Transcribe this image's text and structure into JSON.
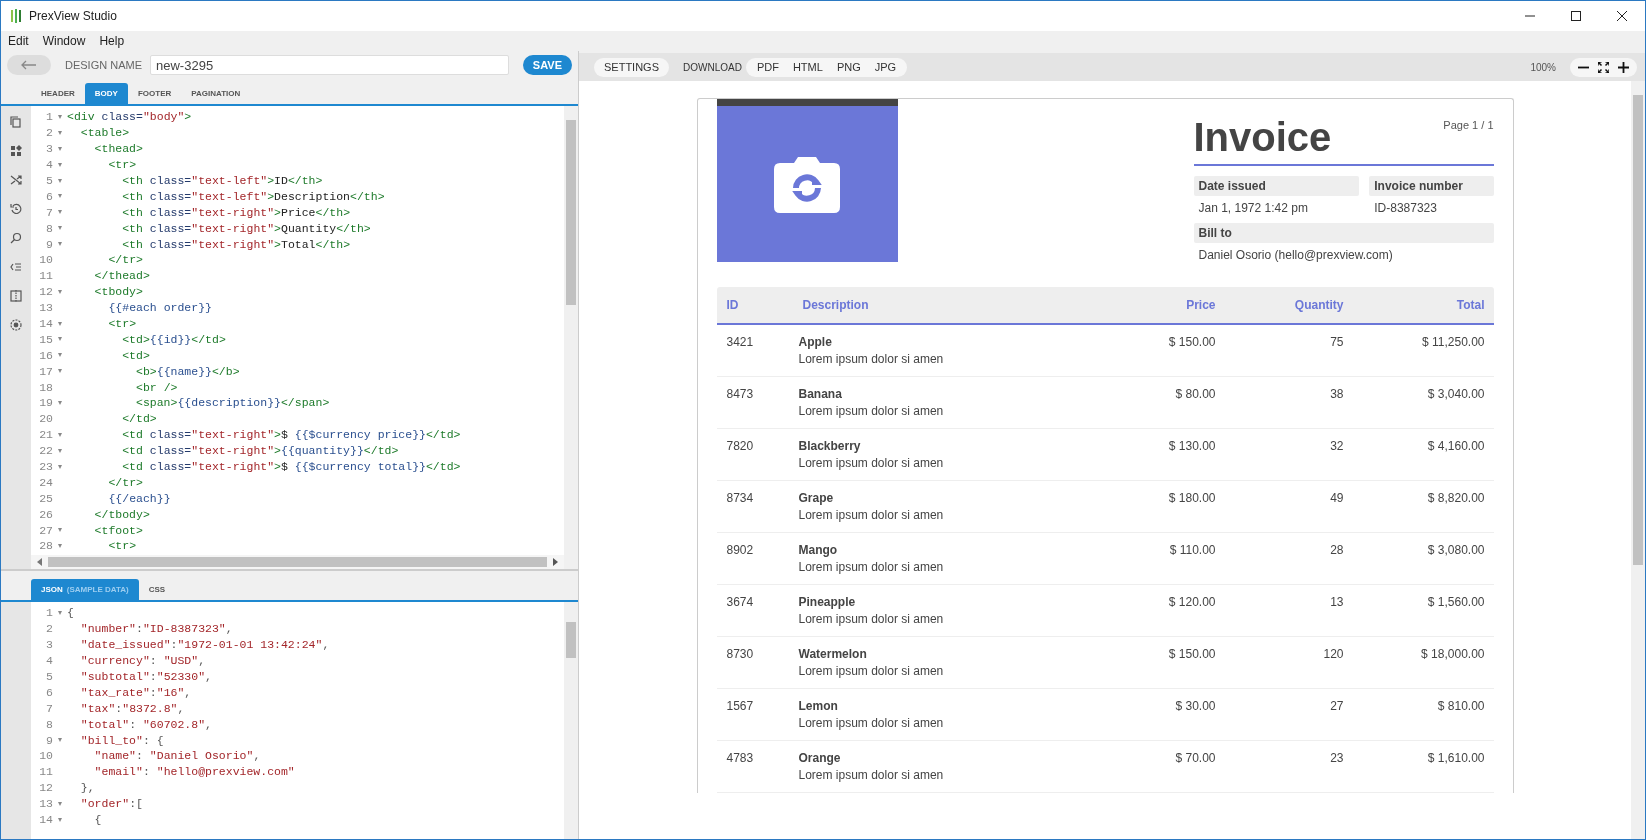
{
  "app": {
    "title": "PrexView Studio"
  },
  "menu": [
    "Edit",
    "Window",
    "Help"
  ],
  "toolbar": {
    "label": "DESIGN NAME",
    "design_name": "new-3295",
    "save": "SAVE"
  },
  "template_tabs": [
    {
      "label": "HEADER",
      "selected": false
    },
    {
      "label": "BODY",
      "selected": true
    },
    {
      "label": "FOOTER",
      "selected": false
    },
    {
      "label": "PAGINATION",
      "selected": false
    }
  ],
  "html_editor": {
    "lines": [
      {
        "n": "1",
        "fold": true,
        "text": "<div class=\"body\">"
      },
      {
        "n": "2",
        "fold": true,
        "text": "  <table>"
      },
      {
        "n": "3",
        "fold": true,
        "text": "    <thead>"
      },
      {
        "n": "4",
        "fold": true,
        "text": "      <tr>"
      },
      {
        "n": "5",
        "fold": true,
        "text": "        <th class=\"text-left\">ID</th>"
      },
      {
        "n": "6",
        "fold": true,
        "text": "        <th class=\"text-left\">Description</th>"
      },
      {
        "n": "7",
        "fold": true,
        "text": "        <th class=\"text-right\">Price</th>"
      },
      {
        "n": "8",
        "fold": true,
        "text": "        <th class=\"text-right\">Quantity</th>"
      },
      {
        "n": "9",
        "fold": true,
        "text": "        <th class=\"text-right\">Total</th>"
      },
      {
        "n": "10",
        "fold": false,
        "text": "      </tr>"
      },
      {
        "n": "11",
        "fold": false,
        "text": "    </thead>"
      },
      {
        "n": "12",
        "fold": true,
        "text": "    <tbody>"
      },
      {
        "n": "13",
        "fold": false,
        "text": "      {{#each order}}"
      },
      {
        "n": "14",
        "fold": true,
        "text": "      <tr>"
      },
      {
        "n": "15",
        "fold": true,
        "text": "        <td>{{id}}</td>"
      },
      {
        "n": "16",
        "fold": true,
        "text": "        <td>"
      },
      {
        "n": "17",
        "fold": true,
        "text": "          <b>{{name}}</b>"
      },
      {
        "n": "18",
        "fold": false,
        "text": "          <br />"
      },
      {
        "n": "19",
        "fold": true,
        "text": "          <span>{{description}}</span>"
      },
      {
        "n": "20",
        "fold": false,
        "text": "        </td>"
      },
      {
        "n": "21",
        "fold": true,
        "text": "        <td class=\"text-right\">$ {{$currency price}}</td>"
      },
      {
        "n": "22",
        "fold": true,
        "text": "        <td class=\"text-right\">{{quantity}}</td>"
      },
      {
        "n": "23",
        "fold": true,
        "text": "        <td class=\"text-right\">$ {{$currency total}}</td>"
      },
      {
        "n": "24",
        "fold": false,
        "text": "      </tr>"
      },
      {
        "n": "25",
        "fold": false,
        "text": "      {{/each}}"
      },
      {
        "n": "26",
        "fold": false,
        "text": "    </tbody>"
      },
      {
        "n": "27",
        "fold": true,
        "text": "    <tfoot>"
      },
      {
        "n": "28",
        "fold": true,
        "text": "      <tr>"
      }
    ]
  },
  "data_tabs": [
    {
      "label": "JSON",
      "note": "(SAMPLE DATA)",
      "selected": true
    },
    {
      "label": "CSS",
      "selected": false
    }
  ],
  "json_editor": {
    "lines": [
      {
        "n": "1",
        "fold": true,
        "text": "{"
      },
      {
        "n": "2",
        "fold": false,
        "text": "  \"number\":\"ID-8387323\","
      },
      {
        "n": "3",
        "fold": false,
        "text": "  \"date_issued\":\"1972-01-01 13:42:24\","
      },
      {
        "n": "4",
        "fold": false,
        "text": "  \"currency\": \"USD\","
      },
      {
        "n": "5",
        "fold": false,
        "text": "  \"subtotal\":\"52330\","
      },
      {
        "n": "6",
        "fold": false,
        "text": "  \"tax_rate\":\"16\","
      },
      {
        "n": "7",
        "fold": false,
        "text": "  \"tax\":\"8372.8\","
      },
      {
        "n": "8",
        "fold": false,
        "text": "  \"total\": \"60702.8\","
      },
      {
        "n": "9",
        "fold": true,
        "text": "  \"bill_to\": {"
      },
      {
        "n": "10",
        "fold": false,
        "text": "    \"name\": \"Daniel Osorio\","
      },
      {
        "n": "11",
        "fold": false,
        "text": "    \"email\": \"hello@prexview.com\""
      },
      {
        "n": "12",
        "fold": false,
        "text": "  },"
      },
      {
        "n": "13",
        "fold": true,
        "text": "  \"order\":["
      },
      {
        "n": "14",
        "fold": true,
        "text": "    {"
      }
    ]
  },
  "preview_toolbar": {
    "settings": "SETTINGS",
    "download_label": "DOWNLOAD",
    "formats": [
      "PDF",
      "HTML",
      "PNG",
      "JPG"
    ],
    "zoom": "100%"
  },
  "invoice": {
    "title": "Invoice",
    "page": "Page 1 / 1",
    "fields": [
      {
        "label": "Date issued",
        "value": "Jan 1, 1972 1:42 pm"
      },
      {
        "label": "Invoice number",
        "value": "ID-8387323"
      }
    ],
    "bill_to": {
      "label": "Bill to",
      "value": "Daniel Osorio (hello@prexview.com)"
    },
    "columns": [
      "ID",
      "Description",
      "Price",
      "Quantity",
      "Total"
    ],
    "rows": [
      {
        "id": "3421",
        "name": "Apple",
        "description": "Lorem ipsum dolor si amen",
        "price": "$ 150.00",
        "quantity": "75",
        "total": "$ 11,250.00"
      },
      {
        "id": "8473",
        "name": "Banana",
        "description": "Lorem ipsum dolor si amen",
        "price": "$ 80.00",
        "quantity": "38",
        "total": "$ 3,040.00"
      },
      {
        "id": "7820",
        "name": "Blackberry",
        "description": "Lorem ipsum dolor si amen",
        "price": "$ 130.00",
        "quantity": "32",
        "total": "$ 4,160.00"
      },
      {
        "id": "8734",
        "name": "Grape",
        "description": "Lorem ipsum dolor si amen",
        "price": "$ 180.00",
        "quantity": "49",
        "total": "$ 8,820.00"
      },
      {
        "id": "8902",
        "name": "Mango",
        "description": "Lorem ipsum dolor si amen",
        "price": "$ 110.00",
        "quantity": "28",
        "total": "$ 3,080.00"
      },
      {
        "id": "3674",
        "name": "Pineapple",
        "description": "Lorem ipsum dolor si amen",
        "price": "$ 120.00",
        "quantity": "13",
        "total": "$ 1,560.00"
      },
      {
        "id": "8730",
        "name": "Watermelon",
        "description": "Lorem ipsum dolor si amen",
        "price": "$ 150.00",
        "quantity": "120",
        "total": "$ 18,000.00"
      },
      {
        "id": "1567",
        "name": "Lemon",
        "description": "Lorem ipsum dolor si amen",
        "price": "$ 30.00",
        "quantity": "27",
        "total": "$ 810.00"
      },
      {
        "id": "4783",
        "name": "Orange",
        "description": "Lorem ipsum dolor si amen",
        "price": "$ 70.00",
        "quantity": "23",
        "total": "$ 1,610.00"
      }
    ]
  }
}
